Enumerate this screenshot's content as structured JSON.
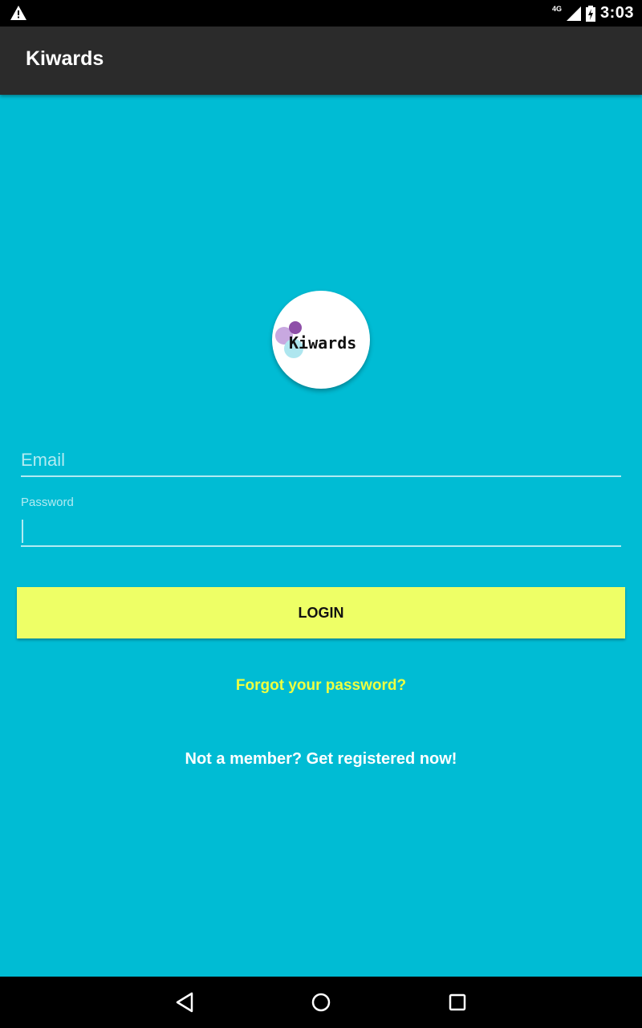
{
  "status_bar": {
    "warning_icon": "warning-icon",
    "network": "4G",
    "time": "3:03"
  },
  "app_bar": {
    "title": "Kiwards"
  },
  "logo": {
    "wordmark": "Kiwards",
    "colors": {
      "purple_dark": "#8e4fa8",
      "purple_light": "#c8a8e0",
      "cyan_light": "#aee6ef"
    }
  },
  "form": {
    "email": {
      "placeholder": "Email",
      "value": ""
    },
    "password": {
      "label": "Password",
      "value": ""
    },
    "login_label": "LOGIN",
    "forgot_label": "Forgot your password?",
    "register_label": "Not a member? Get registered now!"
  },
  "colors": {
    "background": "#00bcd4",
    "app_bar": "#2b2b2b",
    "button": "#eeff66",
    "link": "#eeff41"
  },
  "nav_bar": {
    "icons": [
      "back-icon",
      "home-icon",
      "recent-apps-icon"
    ]
  }
}
